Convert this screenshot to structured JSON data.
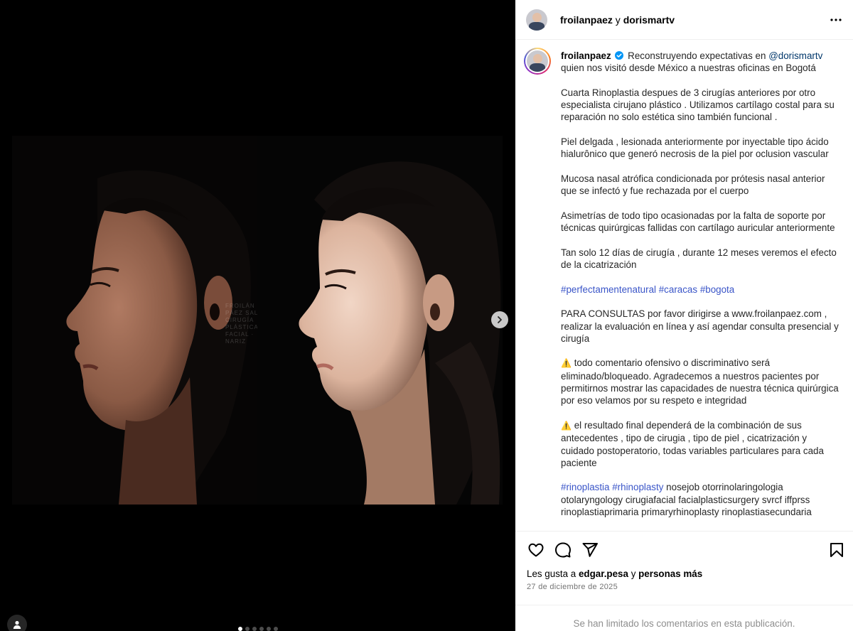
{
  "media": {
    "watermark_lines": [
      "FROILÁN PÁEZ SAL",
      "CIRUGÍA PLÁSTICA",
      "FACIAL · NARIZ"
    ],
    "carousel": {
      "total": 6,
      "active_index": 0
    },
    "next_icon": "chevron-right-icon",
    "tag_icon": "user-tag-icon"
  },
  "header": {
    "owner": "froilanpaez",
    "connector": "y",
    "collaborator": "dorismartv",
    "more_icon": "more-horizontal-icon"
  },
  "caption": {
    "username": "froilanpaez",
    "verified_icon": "verified-badge-icon",
    "intro": "Reconstruyendo expectativas en",
    "mention": "@dorismartv",
    "intro_cont": "quien nos visitó desde México a nuestras oficinas en Bogotá",
    "p1": "Cuarta Rinoplastia despues de 3 cirugías anteriores por otro especialista cirujano plástico . Utilizamos cartílago costal para su reparación no solo estética sino también funcional .",
    "p2": "Piel delgada , lesionada anteriormente por inyectable tipo ácido hialurônico que generó necrosis de la piel por oclusion vascular",
    "p3": "Mucosa nasal atrófica condicionada por prótesis nasal anterior que se infectó y fue rechazada por el cuerpo",
    "p4": "Asimetrías de todo tipo ocasionadas por la falta de soporte por técnicas quirúrgicas fallidas con cartílago auricular anteriormente",
    "p5": "Tan solo 12 días de cirugía , durante 12 meses veremos el efecto de la cicatrización",
    "hashtags1": [
      "#perfectamentenatural",
      "#caracas",
      "#bogota"
    ],
    "p7": "PARA CONSULTAS por favor dirigirse a www.froilanpaez.com , realizar la evaluación en línea y así agendar consulta presencial y cirugía",
    "warn_icon": "⚠️",
    "p8": "todo comentario ofensivo o discriminativo será eliminado/bloqueado. Agradecemos a nuestros pacientes por permitirnos mostrar las capacidades de nuestra técnica quirúrgica por eso velamos por su respeto e integridad",
    "p9": "el resultado final dependerá de la combinación de sus antecedentes , tipo de cirugia , tipo de piel , cicatrización y cuidado postoperatorio, todas variables particulares para cada paciente",
    "hashtags2": [
      "#rinoplastia",
      "#rhinoplasty"
    ],
    "p10_rest": "nosejob otorrinolaringologia otolaryngology cirugiafacial facialplasticsurgery svrcf iffprss rinoplastiaprimaria primaryrhinoplasty rinoplastiasecundaria"
  },
  "actions": {
    "like_icon": "heart-icon",
    "comment_icon": "comment-icon",
    "share_icon": "share-icon",
    "save_icon": "bookmark-icon"
  },
  "likes": {
    "prefix": "Les gusta a",
    "user": "edgar.pesa",
    "connector": "y",
    "others": "personas más"
  },
  "date": "27 de diciembre de 2025",
  "comments_notice": "Se han limitado los comentarios en esta publicación.",
  "colors": {
    "link": "#00376b",
    "hashtag": "#3a55c8",
    "muted": "#737373",
    "border": "#efefef",
    "verified": "#0095f6"
  }
}
